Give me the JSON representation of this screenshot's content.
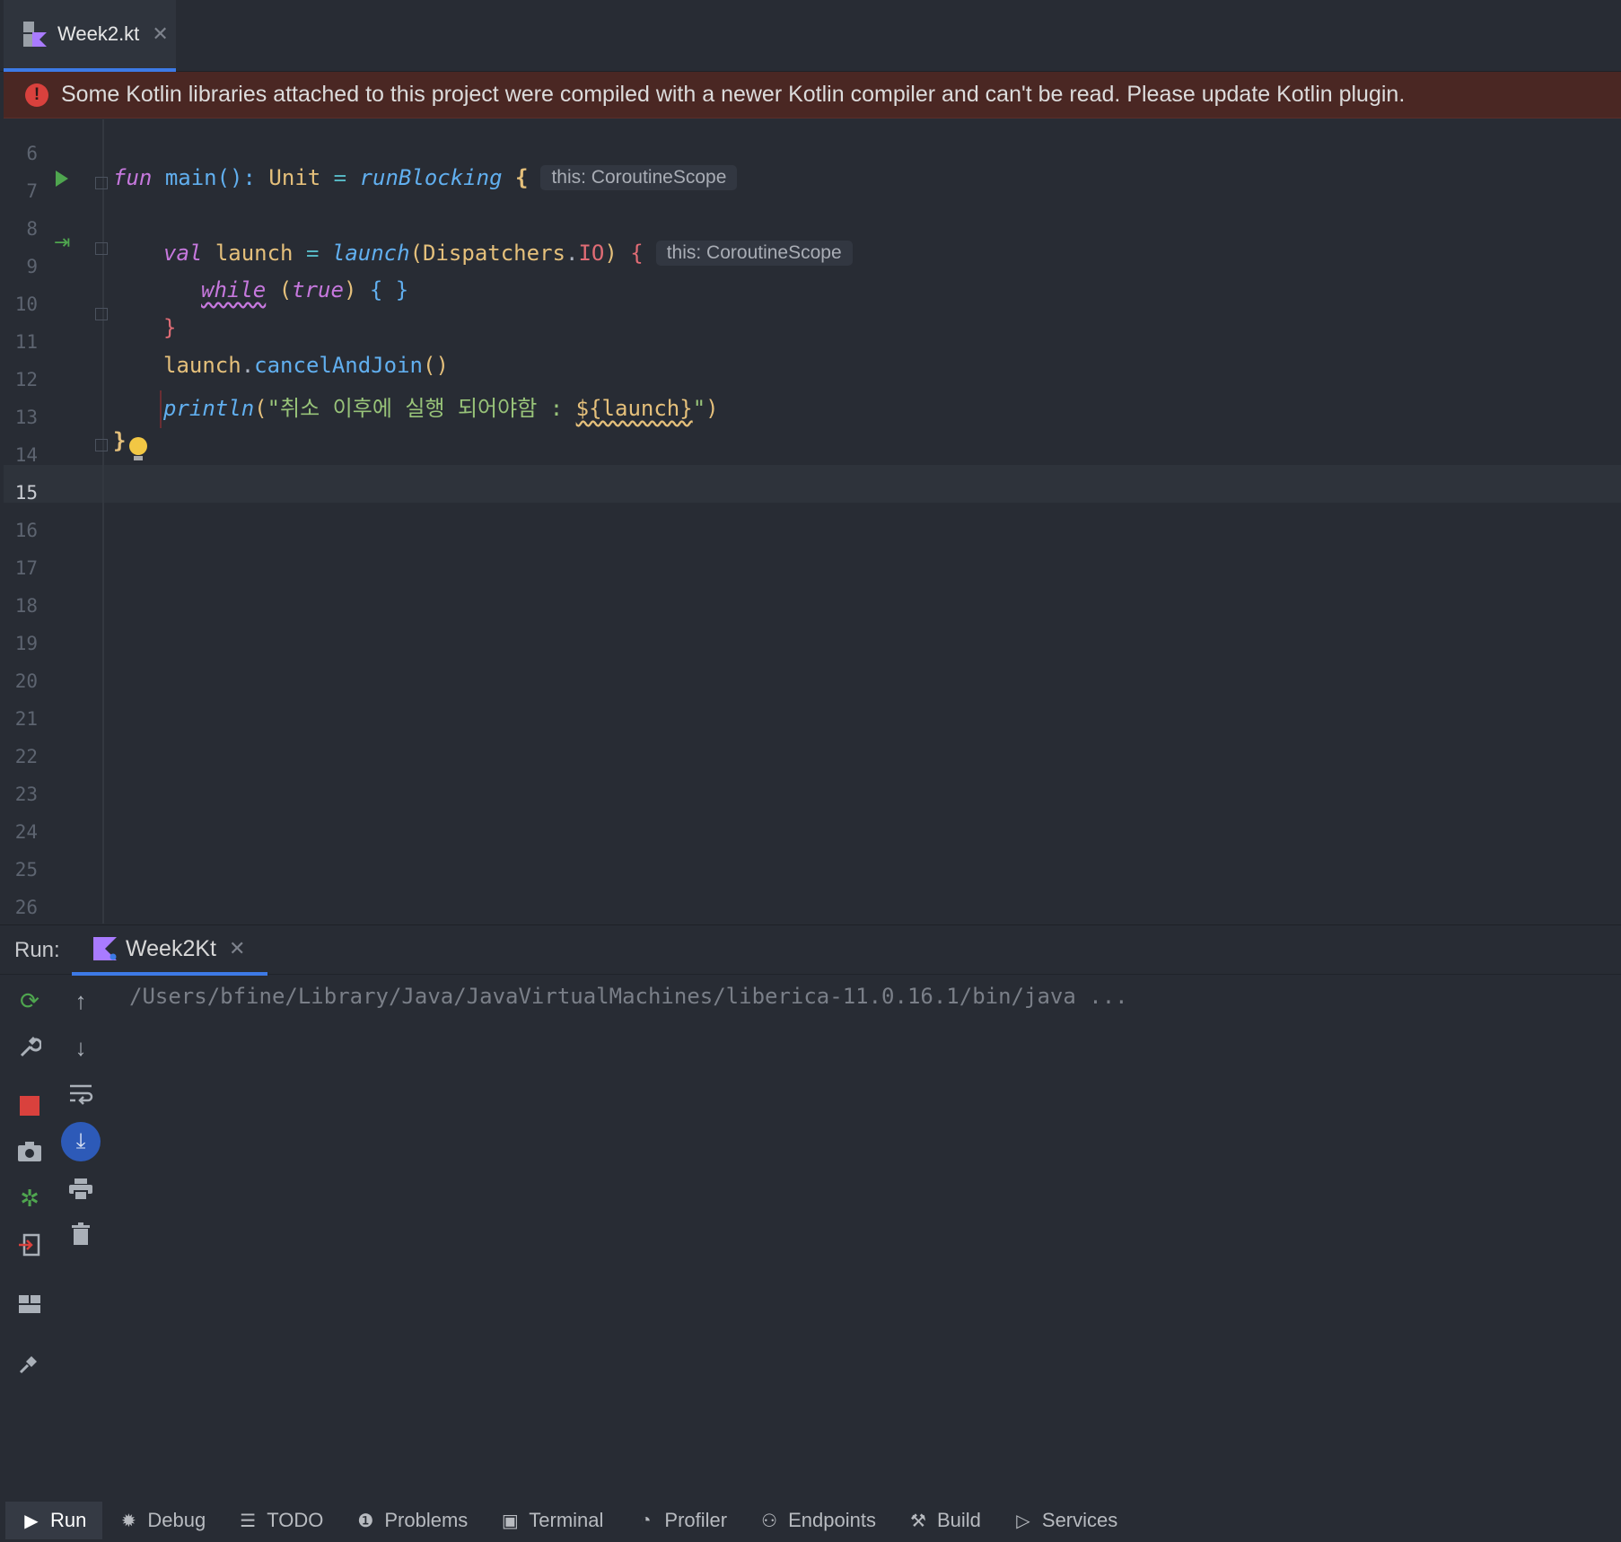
{
  "editor_tab": {
    "label": "Week2.kt",
    "close": "✕"
  },
  "banner": {
    "text": "Some Kotlin libraries attached to this project were compiled with a newer Kotlin compiler and can't be read. Please update Kotlin plugin."
  },
  "line_numbers": [
    "6",
    "7",
    "8",
    "9",
    "10",
    "11",
    "12",
    "13",
    "14",
    "15",
    "16",
    "17",
    "18",
    "19",
    "20",
    "21",
    "22",
    "23",
    "24",
    "25",
    "26"
  ],
  "current_line": "15",
  "code": {
    "l7": {
      "fun": "fun",
      "main": "main",
      "parens": "():",
      "unit": "Unit",
      "eq": "=",
      "run": "runBlocking",
      "brace": "{",
      "hint": "this: CoroutineScope"
    },
    "l9": {
      "val": "val",
      "name": "launch",
      "eq": "=",
      "fn": "launch",
      "open": "(",
      "disp": "Dispatchers",
      "dot": ".",
      "io": "IO",
      "close": ")",
      "brace": "{",
      "hint": "this: CoroutineScope"
    },
    "l10": {
      "while": "while",
      "cond_open": "(",
      "true": "true",
      "cond_close": ")",
      "body": "{ }"
    },
    "l11": {
      "brace": "}"
    },
    "l12": {
      "obj": "launch",
      "dot": ".",
      "call": "cancelAndJoin",
      "parens": "()"
    },
    "l13": {
      "fn": "println",
      "open": "(",
      "str": "\"취소 이후에 실행 되어야함 : ",
      "tmpl": "${launch}",
      "str_end": "\"",
      "close": ")"
    },
    "l14": {
      "brace": "}"
    }
  },
  "run_panel": {
    "label": "Run:",
    "tab_label": "Week2Kt",
    "close": "✕",
    "console_line": "/Users/bfine/Library/Java/JavaVirtualMachines/liberica-11.0.16.1/bin/java ..."
  },
  "bottom_bar": [
    {
      "label": "Run",
      "icon": "play-icon",
      "active": true
    },
    {
      "label": "Debug",
      "icon": "bug-icon"
    },
    {
      "label": "TODO",
      "icon": "list-icon"
    },
    {
      "label": "Problems",
      "icon": "alert-icon"
    },
    {
      "label": "Terminal",
      "icon": "terminal-icon"
    },
    {
      "label": "Profiler",
      "icon": "profiler-icon"
    },
    {
      "label": "Endpoints",
      "icon": "endpoints-icon"
    },
    {
      "label": "Build",
      "icon": "hammer-icon"
    },
    {
      "label": "Services",
      "icon": "services-icon"
    }
  ],
  "colors": {
    "accent": "#3d7ae6",
    "error": "#d9413d",
    "run_green": "#4fa64f",
    "background": "#282c34"
  }
}
